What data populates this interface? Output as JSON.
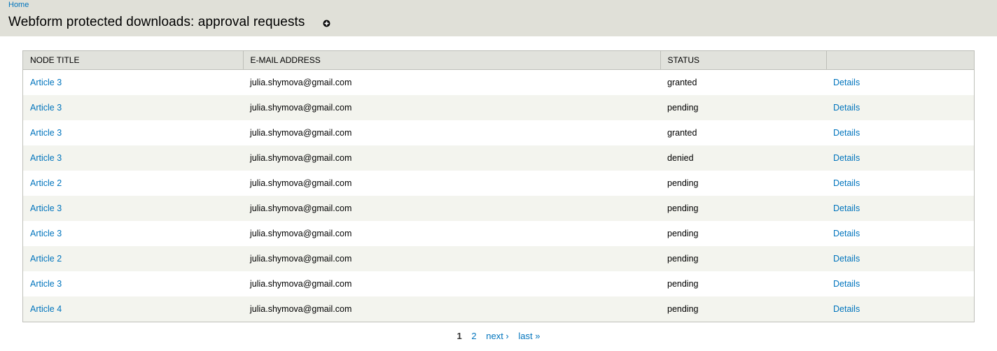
{
  "breadcrumb": {
    "home": "Home"
  },
  "page": {
    "title": "Webform protected downloads: approval requests",
    "shortcut_icon": "add-shortcut-icon"
  },
  "table": {
    "headers": [
      "Node title",
      "E-mail address",
      "Status",
      ""
    ],
    "rows": [
      {
        "node": "Article 3",
        "email": "julia.shymova@gmail.com",
        "status": "granted",
        "action": "Details"
      },
      {
        "node": "Article 3",
        "email": "julia.shymova@gmail.com",
        "status": "pending",
        "action": "Details"
      },
      {
        "node": "Article 3",
        "email": "julia.shymova@gmail.com",
        "status": "granted",
        "action": "Details"
      },
      {
        "node": "Article 3",
        "email": "julia.shymova@gmail.com",
        "status": "denied",
        "action": "Details"
      },
      {
        "node": "Article 2",
        "email": "julia.shymova@gmail.com",
        "status": "pending",
        "action": "Details"
      },
      {
        "node": "Article 3",
        "email": "julia.shymova@gmail.com",
        "status": "pending",
        "action": "Details"
      },
      {
        "node": "Article 3",
        "email": "julia.shymova@gmail.com",
        "status": "pending",
        "action": "Details"
      },
      {
        "node": "Article 2",
        "email": "julia.shymova@gmail.com",
        "status": "pending",
        "action": "Details"
      },
      {
        "node": "Article 3",
        "email": "julia.shymova@gmail.com",
        "status": "pending",
        "action": "Details"
      },
      {
        "node": "Article 4",
        "email": "julia.shymova@gmail.com",
        "status": "pending",
        "action": "Details"
      }
    ]
  },
  "pager": {
    "current": "1",
    "page2": "2",
    "next": "next ›",
    "last": "last »"
  },
  "colors": {
    "header_bg": "#e0e0d8",
    "link": "#0074bd",
    "row_even": "#f3f4ee"
  }
}
